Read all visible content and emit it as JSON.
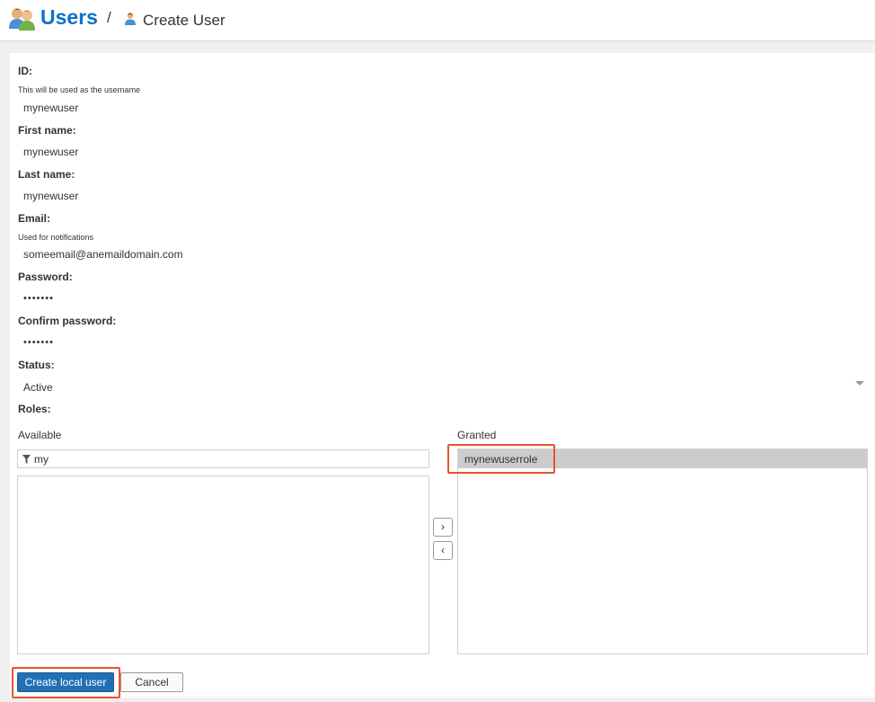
{
  "header": {
    "breadcrumb_root": "Users",
    "breadcrumb_separator": "/",
    "breadcrumb_current": "Create User",
    "root_icon": "users-icon",
    "current_icon": "user-icon"
  },
  "form": {
    "id": {
      "label": "ID:",
      "hint": "This will be used as the username",
      "value": "mynewuser"
    },
    "first_name": {
      "label": "First name:",
      "value": "mynewuser"
    },
    "last_name": {
      "label": "Last name:",
      "value": "mynewuser"
    },
    "email": {
      "label": "Email:",
      "hint": "Used for notifications",
      "value": "someemail@anemaildomain.com"
    },
    "password": {
      "label": "Password:",
      "value": "•••••••"
    },
    "confirm_password": {
      "label": "Confirm password:",
      "value": "•••••••"
    },
    "status": {
      "label": "Status:",
      "value": "Active"
    },
    "roles": {
      "label": "Roles:",
      "available_label": "Available",
      "granted_label": "Granted",
      "filter_value": "my",
      "available_items": [],
      "granted_items": [
        "mynewuserrole"
      ],
      "move_right": "›",
      "move_left": "‹"
    }
  },
  "actions": {
    "create": "Create local user",
    "cancel": "Cancel"
  },
  "colors": {
    "accent": "#0b72c7",
    "primary_button": "#236fb5",
    "highlight": "#e8542c",
    "selected_row": "#cccccc"
  }
}
